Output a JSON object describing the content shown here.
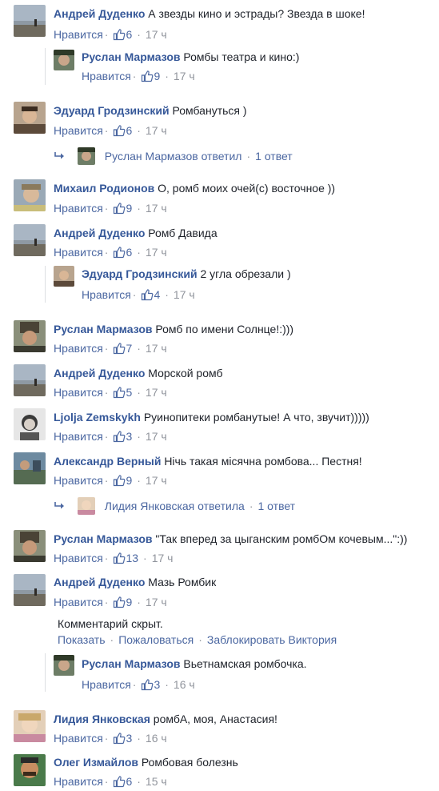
{
  "ui": {
    "like": "Нравится",
    "show": "Показать",
    "report": "Пожаловаться",
    "block": "Заблокировать Виктория",
    "hidden": "Комментарий скрыт."
  },
  "comments": [
    {
      "name": "Андрей Дуденко",
      "text": "А звезды кино и эстрады? Звезда в шоке!",
      "likes": "6",
      "time": "17 ч"
    },
    {
      "name": "Руслан Мармазов",
      "text": "Ромбы театра и кино:)",
      "likes": "9",
      "time": "17 ч"
    },
    {
      "name": "Эдуард Гродзинский",
      "text": "Ромбануться )",
      "likes": "6",
      "time": "17 ч"
    },
    {
      "name": "Руслан Мармазов",
      "text": "ответил",
      "replies": "1 ответ"
    },
    {
      "name": "Михаил Родионов",
      "text": "О, ромб моих очей(с) восточное ))",
      "likes": "9",
      "time": "17 ч"
    },
    {
      "name": "Андрей Дуденко",
      "text": "Ромб Давида",
      "likes": "6",
      "time": "17 ч"
    },
    {
      "name": "Эдуард Гродзинский",
      "text": "2 угла обрезали )",
      "likes": "4",
      "time": "17 ч"
    },
    {
      "name": "Руслан Мармазов",
      "text": "Ромб по имени Солнце!:)))",
      "likes": "7",
      "time": "17 ч"
    },
    {
      "name": "Андрей Дуденко",
      "text": "Морской ромб",
      "likes": "5",
      "time": "17 ч"
    },
    {
      "name": "Ljolja Zemskykh",
      "text": "Руинопитеки ромбанутые! А что, звучит)))))",
      "likes": "3",
      "time": "17 ч"
    },
    {
      "name": "Александр Верный",
      "text": "Нічь такая місячна ромбова... Пестня!",
      "likes": "9",
      "time": "17 ч"
    },
    {
      "name": "Лидия Янковская",
      "text": "ответила",
      "replies": "1 ответ"
    },
    {
      "name": "Руслан Мармазов",
      "text": "\"Так вперед за цыганским ромбОм кочевым...\":))",
      "likes": "13",
      "time": "17 ч"
    },
    {
      "name": "Андрей Дуденко",
      "text": "Мазь Ромбик",
      "likes": "9",
      "time": "17 ч"
    },
    {
      "name": "Руслан Мармазов",
      "text": "Вьетнамская ромбочка.",
      "likes": "3",
      "time": "16 ч"
    },
    {
      "name": "Лидия Янковская",
      "text": "ромбА, моя, Анастасия!",
      "likes": "3",
      "time": "16 ч"
    },
    {
      "name": "Олег Измайлов",
      "text": "Ромбовая болезнь",
      "likes": "6",
      "time": "15 ч"
    }
  ]
}
